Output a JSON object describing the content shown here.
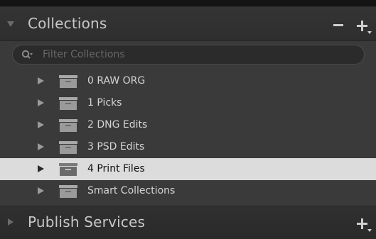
{
  "collections_panel": {
    "title": "Collections",
    "search_placeholder": "Filter Collections",
    "items": [
      {
        "label": "0 RAW ORG",
        "selected": false
      },
      {
        "label": "1 Picks",
        "selected": false
      },
      {
        "label": "2 DNG Edits",
        "selected": false
      },
      {
        "label": "3 PSD Edits",
        "selected": false
      },
      {
        "label": "4 Print Files",
        "selected": true
      },
      {
        "label": "Smart Collections",
        "selected": false
      }
    ]
  },
  "publish_panel": {
    "title": "Publish Services"
  },
  "icons": {
    "collapse": "triangle-down-icon",
    "expand": "triangle-right-icon",
    "remove": "minus-icon",
    "add": "plus-icon",
    "search": "search-icon",
    "collection_set": "collection-set-box-icon"
  },
  "colors": {
    "panel_bg": "#3a3a3a",
    "selected_row": "#dcdcdc",
    "text": "#d4d4d4"
  }
}
